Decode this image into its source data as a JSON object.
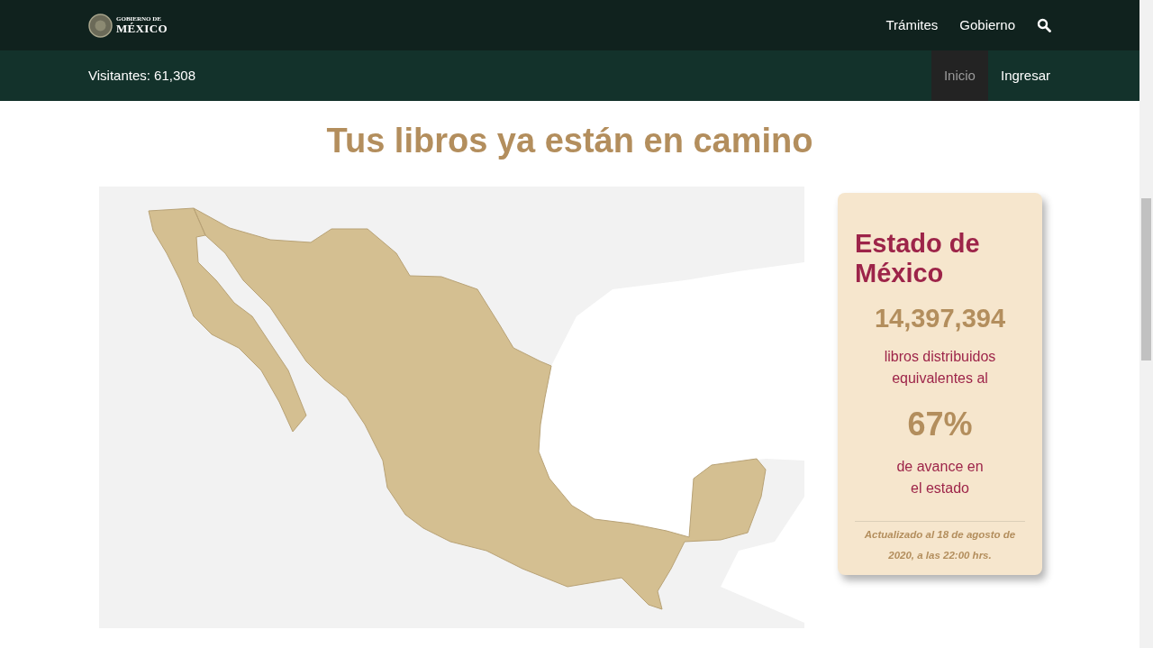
{
  "header": {
    "logo": {
      "line_1": "GOBIERNO DE",
      "line_2": "MÉXICO"
    },
    "nav": [
      "Trámites",
      "Gobierno"
    ]
  },
  "subheader": {
    "visitors": "Visitantes: 61,308",
    "tabs": [
      {
        "label": "Inicio",
        "selected": true
      },
      {
        "label": "Ingresar",
        "selected": false
      }
    ]
  },
  "title": "Tus libros ya están en camino",
  "card": {
    "state": "Estado de México",
    "books": "14,397,394",
    "books_caption": "libros distribuidos equivalentes al",
    "percent": "67%",
    "percent_caption": "de avance en el estado",
    "updated": "Actualizado al 18 de agosto de 2020, a las 22:00 hrs."
  }
}
